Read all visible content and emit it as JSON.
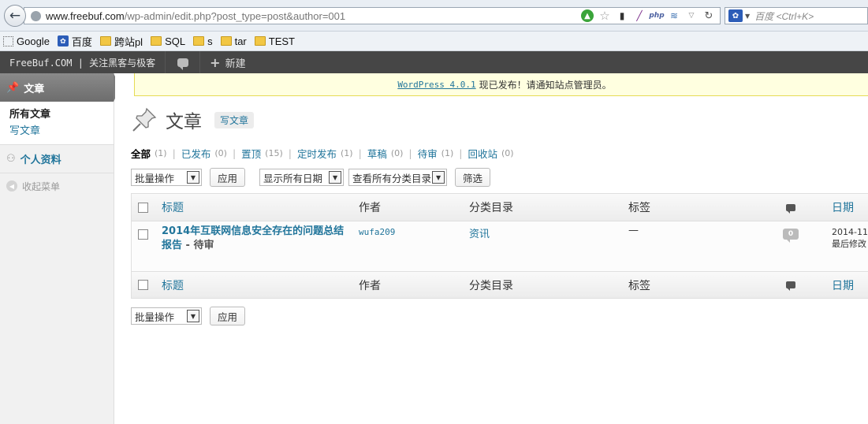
{
  "browser": {
    "url_domain": "www.freebuf.com",
    "url_path": "/wp-admin/edit.php?post_type=post&author=001",
    "search_placeholder": "百度 <Ctrl+K>"
  },
  "bookmarks": [
    "Google",
    "百度",
    "跨站pl",
    "SQL",
    "s",
    "tar",
    "TEST"
  ],
  "adminbar": {
    "site_label": "FreeBuf.COM | 关注黑客与极客",
    "new_label": "新建"
  },
  "sidebar": {
    "active_menu": "文章",
    "sub_current": "所有文章",
    "sub_add": "写文章",
    "profile": "个人资料",
    "collapse": "收起菜单"
  },
  "notice": {
    "link": "WordPress 4.0.1",
    "text": "现已发布！请通知站点管理员。"
  },
  "page": {
    "title": "文章",
    "add_new": "写文章"
  },
  "status": [
    {
      "label": "全部",
      "count": "(1)"
    },
    {
      "label": "已发布",
      "count": "(0)"
    },
    {
      "label": "置顶",
      "count": "(15)"
    },
    {
      "label": "定时发布",
      "count": "(1)"
    },
    {
      "label": "草稿",
      "count": "(0)"
    },
    {
      "label": "待审",
      "count": "(1)"
    },
    {
      "label": "回收站",
      "count": "(0)"
    }
  ],
  "filters": {
    "bulk": "批量操作",
    "apply": "应用",
    "dates": "显示所有日期",
    "cats": "查看所有分类目录",
    "filter_btn": "筛选"
  },
  "columns": {
    "title": "标题",
    "author": "作者",
    "categories": "分类目录",
    "tags": "标签",
    "date": "日期"
  },
  "post": {
    "title": "2014年互联网信息安全存在的问题总结报告",
    "state": " - 待审",
    "author": "wufa209",
    "category": "资讯",
    "tags": "—",
    "comments": "0",
    "date_line1": "2014-11-",
    "date_line2": "最后修改"
  }
}
